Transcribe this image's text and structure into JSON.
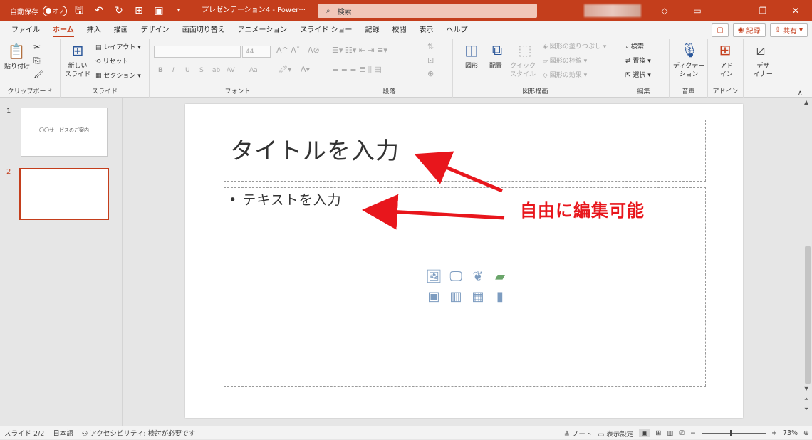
{
  "titlebar": {
    "autosave_label": "自動保存",
    "autosave_state": "オフ",
    "doc_title": "プレゼンテーション4 - Power···",
    "search_placeholder": "検索",
    "accent_color": "#c43e1c",
    "buttons": [
      "diamond-icon",
      "ribbon-display-icon",
      "minimize-icon",
      "restore-icon",
      "close-icon"
    ]
  },
  "tabs": {
    "items": [
      "ファイル",
      "ホーム",
      "挿入",
      "描画",
      "デザイン",
      "画面切り替え",
      "アニメーション",
      "スライド ショー",
      "記録",
      "校閲",
      "表示",
      "ヘルプ"
    ],
    "active": "ホーム",
    "record_label": "記録",
    "share_label": "共有"
  },
  "ribbon": {
    "clipboard": {
      "paste": "貼り付け",
      "label": "クリップボード"
    },
    "slides": {
      "new_slide": "新しい\nスライド",
      "layout": "レイアウト",
      "reset": "リセット",
      "section": "セクション",
      "label": "スライド"
    },
    "font": {
      "size": "44",
      "label": "フォント",
      "bold": "B",
      "italic": "I",
      "underline": "U",
      "shadow": "S",
      "strike": "ab",
      "spacing": "AV",
      "case": "Aa"
    },
    "paragraph": {
      "label": "段落"
    },
    "drawing": {
      "shapes": "図形",
      "arrange": "配置",
      "quick_styles": "クイック\nスタイル",
      "fill": "図形の塗りつぶし",
      "outline": "図形の枠線",
      "effects": "図形の効果",
      "label": "図形描画"
    },
    "editing": {
      "find": "検索",
      "replace": "置換",
      "select": "選択",
      "label": "編集"
    },
    "voice": {
      "dictate": "ディクテー\nション",
      "label": "音声"
    },
    "addins": {
      "addins": "アド\nイン",
      "label": "アドイン"
    },
    "designer": {
      "designer": "デザ\nイナー"
    }
  },
  "thumbnails": [
    {
      "number": "1",
      "text": "〇〇サービスのご案内",
      "selected": false
    },
    {
      "number": "2",
      "text": "",
      "selected": true
    }
  ],
  "slide": {
    "title_placeholder": "タイトルを入力",
    "body_placeholder": "• テキストを入力",
    "insert_icons": [
      "picture-icon",
      "stock-images-icon",
      "icons-insert-icon",
      "smartart-icon",
      "cameo-icon",
      "video-icon",
      "table-icon",
      "chart-icon"
    ]
  },
  "annotation": {
    "text": "自由に編集可能",
    "color": "#e8161c"
  },
  "statusbar": {
    "slide_count": "スライド 2/2",
    "language": "日本語",
    "accessibility": "アクセシビリティ: 検討が必要です",
    "notes": "ノート",
    "display_settings": "表示設定",
    "zoom": "73%"
  }
}
